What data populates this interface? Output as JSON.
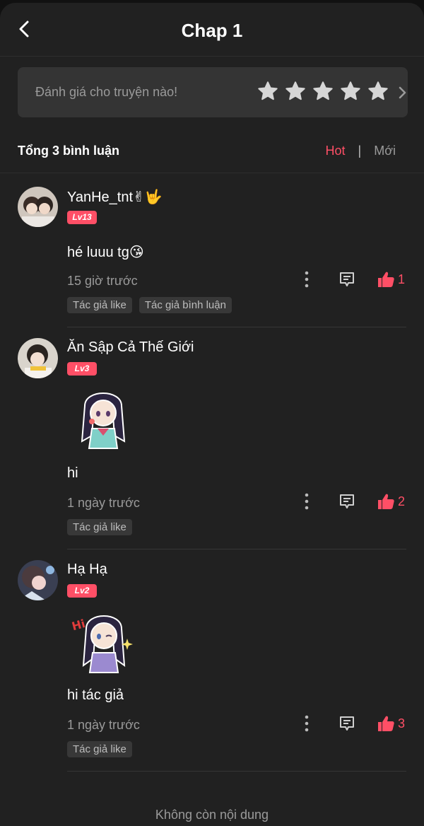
{
  "header": {
    "title": "Chap 1",
    "back_icon": "chevron-left-icon"
  },
  "rating": {
    "prompt": "Đánh giá cho truyện nào!",
    "stars": 5,
    "star_icon": "star-icon",
    "chevron_icon": "chevron-right-icon"
  },
  "comments_header": {
    "total": "Tổng 3 bình luận",
    "sort_hot": "Hot",
    "sort_separator": "|",
    "sort_new": "Mới"
  },
  "comments": [
    {
      "name": "YanHe_tnt✌🤟",
      "level": "Lv13",
      "avatar_icon": "avatar-photo",
      "text": "hé luuu tg😘",
      "time": "15 giờ trước",
      "likes": "1",
      "tags": [
        "Tác giả like",
        "Tác giả bình luận"
      ]
    },
    {
      "name": "Ăn Sập Cả Thế Giới",
      "level": "Lv3",
      "avatar_icon": "avatar-photo",
      "sticker_icon": "anime-girl-sticker",
      "text": "hi",
      "time": "1 ngày trước",
      "likes": "2",
      "tags": [
        "Tác giả like"
      ]
    },
    {
      "name": "Hạ Hạ",
      "level": "Lv2",
      "avatar_icon": "avatar-photo",
      "sticker_icon": "anime-girl-hi-sticker",
      "sticker_text": "Hi",
      "text": "hi tác giả",
      "time": "1 ngày trước",
      "likes": "3",
      "tags": [
        "Tác giả like"
      ]
    }
  ],
  "footer": {
    "text": "Không còn nội dung"
  },
  "colors": {
    "accent": "#ff4f66",
    "background": "#212121",
    "card": "#343434",
    "muted": "#9a9a9a"
  }
}
